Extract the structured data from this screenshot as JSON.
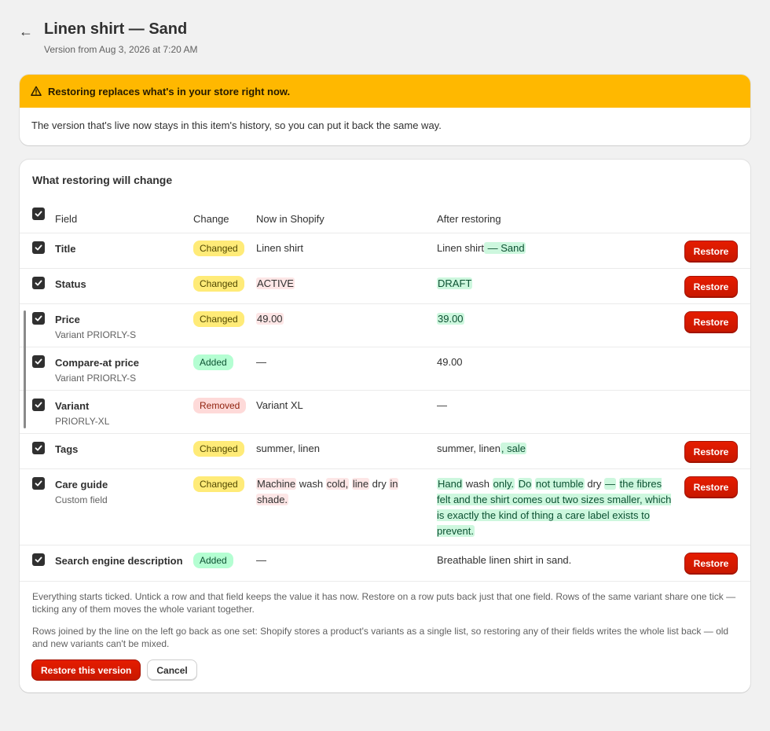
{
  "header": {
    "back_icon": "arrow-left-icon",
    "title": "Linen shirt — Sand",
    "subtitle": "Version from Aug 3, 2026 at 7:20 AM"
  },
  "banner": {
    "icon": "warning-triangle-icon",
    "heading": "Restoring replaces what's in your store right now.",
    "body": "The version that's live now stays in this item's history, so you can put it back the same way."
  },
  "changes": {
    "title": "What restoring will change",
    "columns": {
      "field": "Field",
      "change": "Change",
      "now": "Now in Shopify",
      "after": "After restoring"
    },
    "rows": [
      {
        "field": "Title",
        "sub": "",
        "change": "Changed",
        "restore": "Restore",
        "now": [
          {
            "t": "Linen shirt",
            "k": ""
          }
        ],
        "after": [
          {
            "t": "Linen shirt",
            "k": ""
          },
          {
            "t": " — Sand",
            "k": "ins"
          }
        ]
      },
      {
        "field": "Status",
        "sub": "",
        "change": "Changed",
        "restore": "Restore",
        "now": [
          {
            "t": "ACTIVE",
            "k": "del"
          }
        ],
        "after": [
          {
            "t": "DRAFT",
            "k": "ins"
          }
        ]
      },
      {
        "field": "Price",
        "sub": "Variant PRIORLY-S",
        "change": "Changed",
        "restore": "Restore",
        "now": [
          {
            "t": "49.00",
            "k": "del"
          }
        ],
        "after": [
          {
            "t": "39.00",
            "k": "ins"
          }
        ]
      },
      {
        "field": "Compare-at price",
        "sub": "Variant PRIORLY-S",
        "change": "Added",
        "restore": "",
        "now": [
          {
            "t": "—",
            "k": ""
          }
        ],
        "after": [
          {
            "t": "49.00",
            "k": ""
          }
        ]
      },
      {
        "field": "Variant",
        "sub": "PRIORLY-XL",
        "change": "Removed",
        "restore": "",
        "now": [
          {
            "t": "Variant XL",
            "k": ""
          }
        ],
        "after": [
          {
            "t": "—",
            "k": ""
          }
        ]
      },
      {
        "field": "Tags",
        "sub": "",
        "change": "Changed",
        "restore": "Restore",
        "now": [
          {
            "t": "summer, linen",
            "k": ""
          }
        ],
        "after": [
          {
            "t": "summer, linen",
            "k": ""
          },
          {
            "t": ", sale",
            "k": "ins"
          }
        ]
      },
      {
        "field": "Care guide",
        "sub": "Custom field",
        "change": "Changed",
        "restore": "Restore",
        "now": [
          {
            "t": "Machine",
            "k": "del"
          },
          {
            "t": " wash ",
            "k": ""
          },
          {
            "t": "cold,",
            "k": "del"
          },
          {
            "t": " ",
            "k": ""
          },
          {
            "t": "line",
            "k": "del"
          },
          {
            "t": " dry ",
            "k": ""
          },
          {
            "t": "in",
            "k": "del"
          },
          {
            "t": " ",
            "k": ""
          },
          {
            "t": "shade.",
            "k": "del"
          }
        ],
        "after": [
          {
            "t": "Hand",
            "k": "ins"
          },
          {
            "t": " wash ",
            "k": ""
          },
          {
            "t": "only.",
            "k": "ins"
          },
          {
            "t": " ",
            "k": ""
          },
          {
            "t": "Do",
            "k": "ins"
          },
          {
            "t": " ",
            "k": ""
          },
          {
            "t": "not tumble",
            "k": "ins"
          },
          {
            "t": " dry ",
            "k": ""
          },
          {
            "t": "—",
            "k": "ins"
          },
          {
            "t": " ",
            "k": ""
          },
          {
            "t": "the fibres felt and the shirt comes out two sizes smaller, which is exactly the kind of thing a care label exists to prevent.",
            "k": "ins"
          }
        ]
      },
      {
        "field": "Search engine description",
        "sub": "",
        "change": "Added",
        "restore": "Restore",
        "now": [
          {
            "t": "—",
            "k": ""
          }
        ],
        "after": [
          {
            "t": "Breathable linen shirt in sand.",
            "k": ""
          }
        ]
      }
    ]
  },
  "notes": [
    "Everything starts ticked. Untick a row and that field keeps the value it has now. Restore on a row puts back just that one field. Rows of the same variant share one tick — ticking any of them moves the whole variant together.",
    "Rows joined by the line on the left go back as one set: Shopify stores a product's variants as a single list, so restoring any of their fields writes the whole list back — old and new variants can't be mixed."
  ],
  "actions": {
    "primary": "Restore this version",
    "secondary": "Cancel"
  },
  "colors": {
    "accent_red": "#e51c00",
    "warning_yellow": "#ffb800",
    "changed_badge": "#ffeb78",
    "added_badge": "#b4fed2",
    "removed_badge": "#fedad9"
  }
}
